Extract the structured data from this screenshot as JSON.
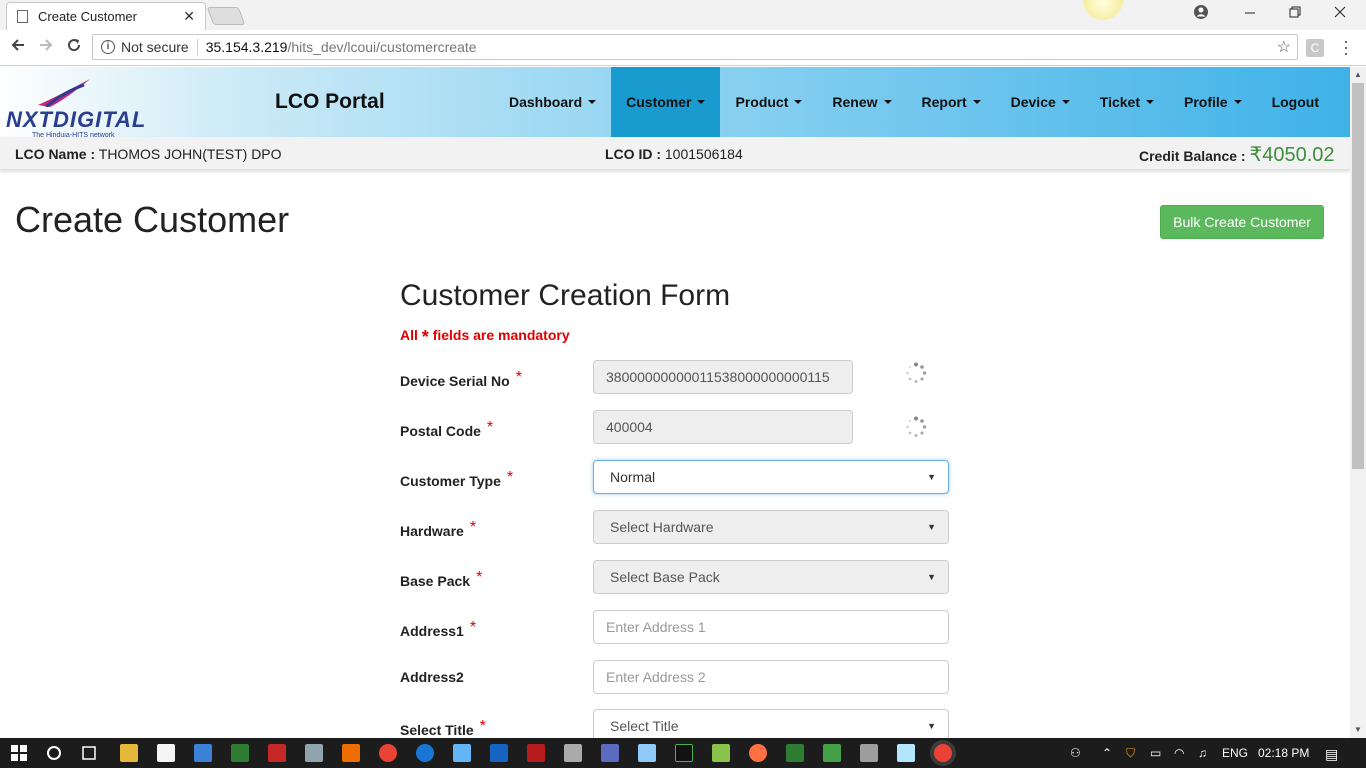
{
  "browser": {
    "tab_title": "Create Customer",
    "tab_close": "✕",
    "security": "Not secure",
    "url_host": "35.154.3.219",
    "url_path": "/hits_dev/lcoui/customercreate"
  },
  "header": {
    "brand": "NXTDIGITAL",
    "tagline": "The Hinduja-HITS network",
    "portal_title": "LCO Portal",
    "nav": [
      {
        "label": "Dashboard"
      },
      {
        "label": "Customer"
      },
      {
        "label": "Product"
      },
      {
        "label": "Renew"
      },
      {
        "label": "Report"
      },
      {
        "label": "Device"
      },
      {
        "label": "Ticket"
      },
      {
        "label": "Profile"
      },
      {
        "label": "Logout"
      }
    ]
  },
  "infobar": {
    "lco_name_label": "LCO Name :",
    "lco_name": "THOMOS JOHN(TEST) DPO",
    "lco_id_label": "LCO ID :",
    "lco_id": "1001506184",
    "credit_label": "Credit Balance :",
    "credit_amount": "₹4050.02"
  },
  "page": {
    "title": "Create Customer",
    "bulk_button": "Bulk Create Customer"
  },
  "form": {
    "title": "Customer Creation Form",
    "mandatory_prefix": "All",
    "mandatory_star": "*",
    "mandatory_suffix": "fields are mandatory",
    "device_serial_label": "Device Serial No",
    "device_serial_value": "38000000000011538000000000115",
    "postal_code_label": "Postal Code",
    "postal_code_value": "400004",
    "customer_type_label": "Customer Type",
    "customer_type_value": "Normal",
    "hardware_label": "Hardware",
    "hardware_value": "Select Hardware",
    "base_pack_label": "Base Pack",
    "base_pack_value": "Select Base Pack",
    "address1_label": "Address1",
    "address1_placeholder": "Enter Address 1",
    "address2_label": "Address2",
    "address2_placeholder": "Enter Address 2",
    "title_label": "Select Title",
    "title_value": "Select Title"
  },
  "taskbar": {
    "lang": "ENG",
    "time": "02:18 PM"
  },
  "colors": {
    "nav_active": "#1a9bd0",
    "header_end": "#3fb2e8",
    "success_button": "#5cb85c",
    "required_red": "#e00000",
    "credit_green": "#3c8f3c"
  }
}
